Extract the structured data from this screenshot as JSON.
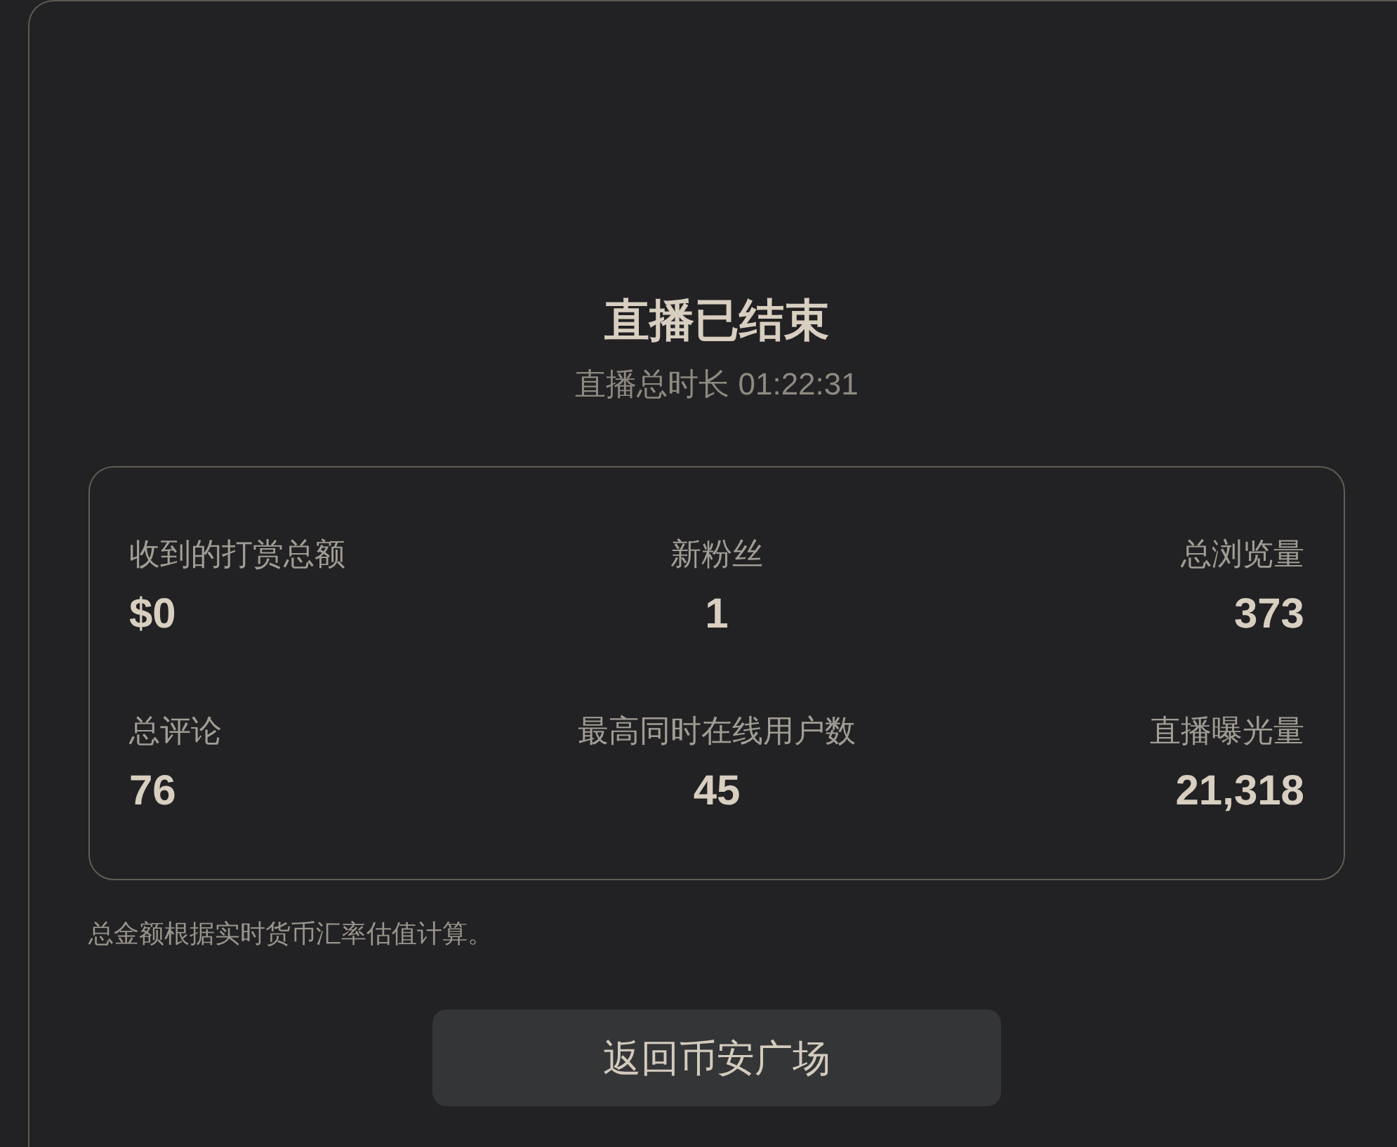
{
  "title": "直播已结束",
  "subtitle": "直播总时长 01:22:31",
  "stats": [
    {
      "label": "收到的打赏总额",
      "value": "$0"
    },
    {
      "label": "新粉丝",
      "value": "1"
    },
    {
      "label": "总浏览量",
      "value": "373"
    },
    {
      "label": "总评论",
      "value": "76"
    },
    {
      "label": "最高同时在线用户数",
      "value": "45"
    },
    {
      "label": "直播曝光量",
      "value": "21,318"
    }
  ],
  "note": "总金额根据实时货币汇率估值计算。",
  "button": {
    "label": "返回币安广场"
  }
}
